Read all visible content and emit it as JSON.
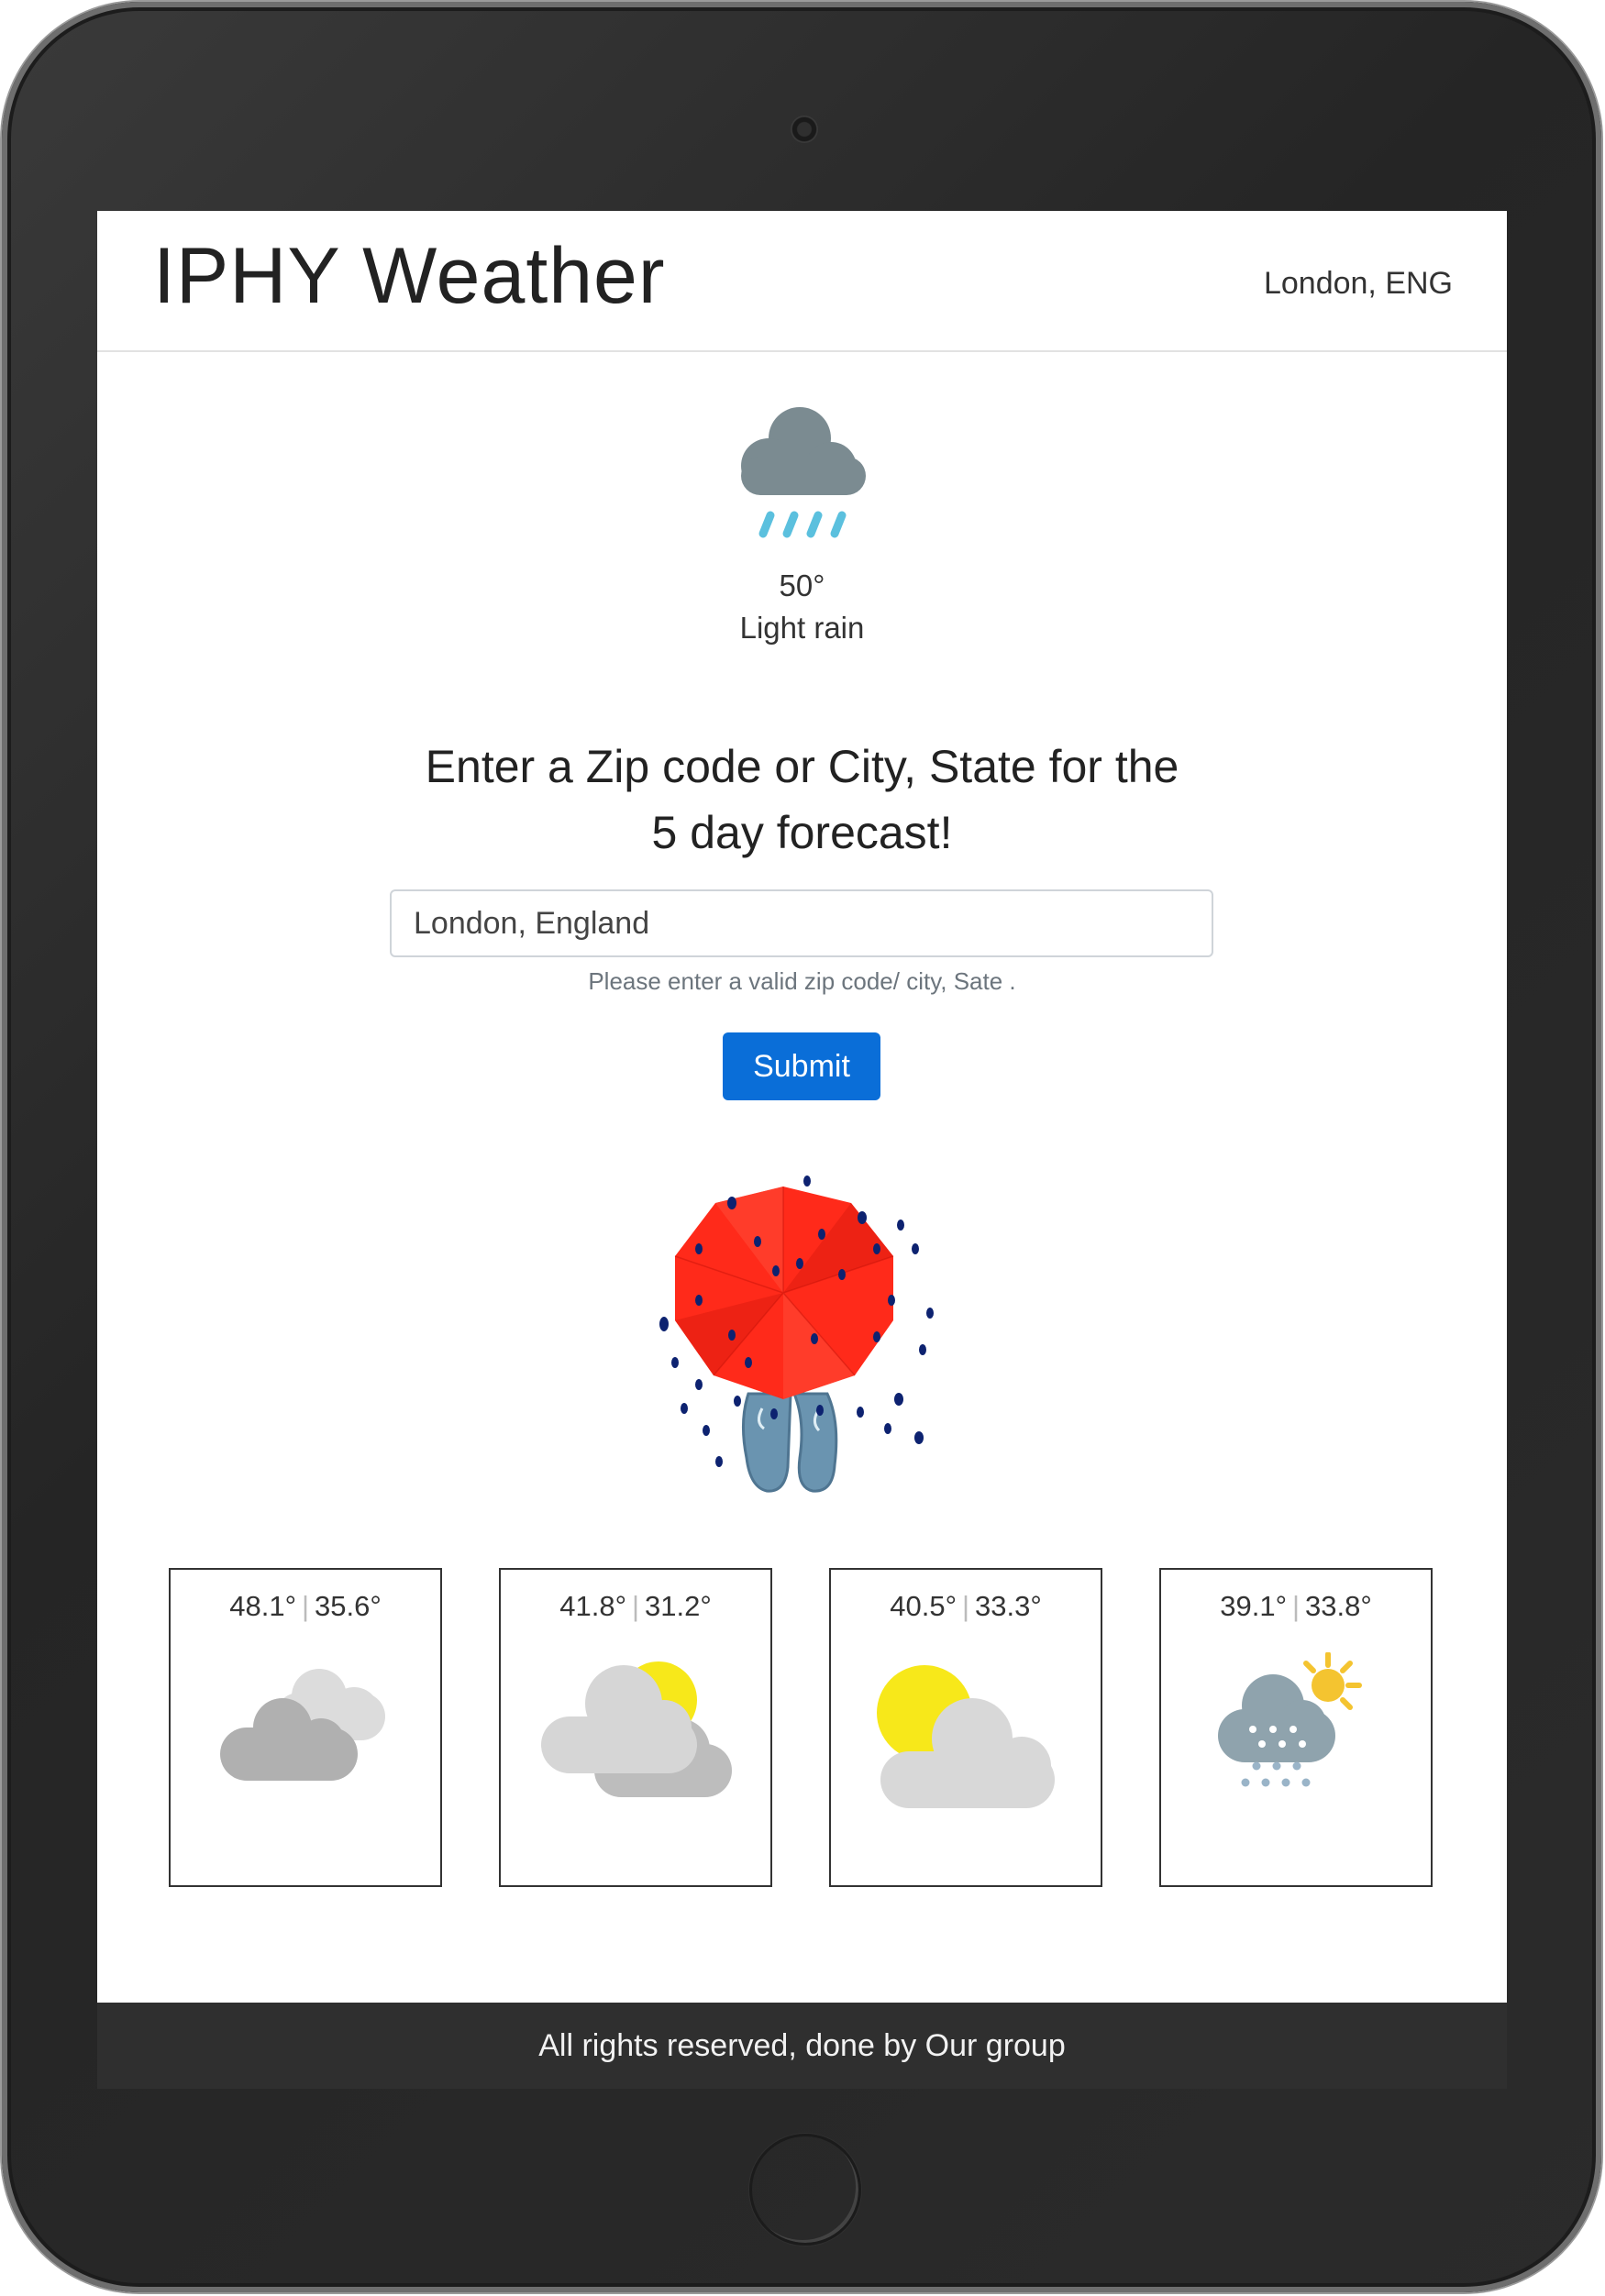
{
  "header": {
    "brand": "IPHY Weather",
    "location": "London, ENG"
  },
  "current": {
    "icon": "rain-cloud-icon",
    "temp": "50°",
    "description": "Light rain"
  },
  "search": {
    "prompt_line1": "Enter a Zip code or City, State for the",
    "prompt_line2": "5 day forecast!",
    "value": "London, England",
    "hint": "Please enter a valid zip code/ city, Sate .",
    "submit_label": "Submit"
  },
  "forecast": [
    {
      "high": "48.1°",
      "low": "35.6°",
      "icon": "cloudy-icon"
    },
    {
      "high": "41.8°",
      "low": "31.2°",
      "icon": "partly-cloudy-icon"
    },
    {
      "high": "40.5°",
      "low": "33.3°",
      "icon": "mostly-sunny-icon"
    },
    {
      "high": "39.1°",
      "low": "33.8°",
      "icon": "snow-sun-icon"
    }
  ],
  "footer": {
    "text": "All rights reserved, done by Our group"
  },
  "colors": {
    "submit": "#0a6ed8",
    "footer": "#2f2f2f",
    "umbrella": "#ff2a1a",
    "rain_drop": "#5bc0de",
    "sun": "#f7e81a"
  }
}
